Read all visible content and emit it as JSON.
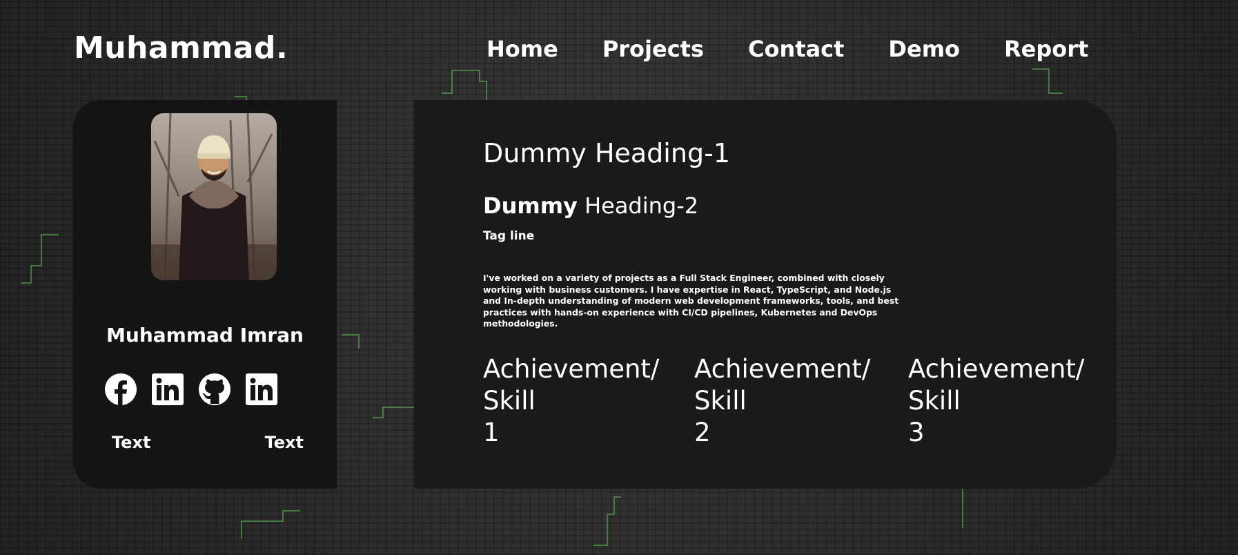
{
  "brand": {
    "logo_text": "Muhammad."
  },
  "nav": {
    "items": [
      {
        "label": "Home"
      },
      {
        "label": "Projects"
      },
      {
        "label": "Contact"
      },
      {
        "label": "Demo"
      },
      {
        "label": "Report"
      }
    ]
  },
  "profile": {
    "name": "Muhammad Imran",
    "socials": [
      {
        "icon": "facebook-icon"
      },
      {
        "icon": "linkedin-icon"
      },
      {
        "icon": "github-icon"
      },
      {
        "icon": "linkedin-icon"
      }
    ],
    "text_left": "Text",
    "text_right": "Text"
  },
  "content": {
    "heading1": "Dummy Heading-1",
    "heading2_bold": "Dummy",
    "heading2_rest": " Heading-2",
    "tagline": "Tag line",
    "description": "I've worked on a variety of projects as a Full Stack Engineer, combined with closely working with business customers. I have expertise in React, TypeScript, and Node.js and In-depth understanding of modern web development frameworks, tools, and best practices with hands-on experience with CI/CD pipelines, Kubernetes and DevOps methodologies.",
    "achievements": [
      {
        "line1": "Achievement/",
        "line2": "Skill",
        "number": "1"
      },
      {
        "line1": "Achievement/",
        "line2": "Skill",
        "number": "2"
      },
      {
        "line1": "Achievement/",
        "line2": "Skill",
        "number": "3"
      }
    ]
  },
  "colors": {
    "background": "#2b2b2b",
    "card_left": "#141414",
    "card_right": "#1a1a1a",
    "text": "#ffffff",
    "circuit_accent": "#4caf50"
  }
}
